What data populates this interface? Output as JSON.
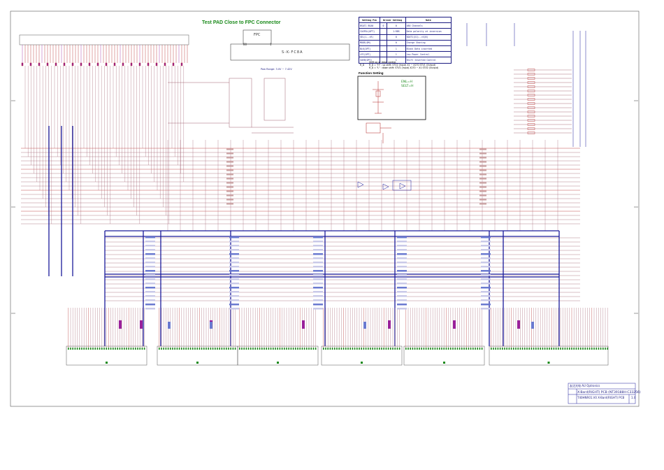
{
  "header": {
    "test_pad_title": "Test PAD Close to FPC Connector",
    "function_setting_title": "Function Setting"
  },
  "fpc": {
    "box_label": "FPC",
    "pin_first": "80",
    "pin_last": "1",
    "part_number": "S-K-FC8A",
    "power_range": "Pow Range: 3.0V ~ 7.42V"
  },
  "setting_table": {
    "headers": [
      "Setting Pin",
      "Driver Setting",
      "Note"
    ],
    "rows": [
      {
        "pin": "BSAT1  BSA0",
        "v1": "0",
        "v2": "0",
        "note": "480 Channels"
      },
      {
        "pin": "CASPOL(OPT)",
        "v1": "",
        "v2": "1:RBS",
        "note": "Data polarity at inversion"
      },
      {
        "pin": "SEL(L-->R)",
        "v1": "",
        "v2": "0",
        "note": "SOUT1(X1)-->X(N)"
      },
      {
        "pin": "MODE(OM)",
        "v1": "",
        "v2": "0",
        "note": "Charge Sharing"
      },
      {
        "pin": "BLK(OPT)",
        "v1": "",
        "v2": "1",
        "note": "Black Data inserted"
      },
      {
        "pin": "LPC(OPT)",
        "v1": "",
        "v2": "1",
        "note": "Low Power Control"
      },
      {
        "pin": "SOEB(OPT)",
        "v1": "",
        "v2": "1",
        "note": "Shift Inserted Control"
      }
    ],
    "footnote_key": "R_D",
    "footnote_lines": [
      "Shift up or down control.",
      "R_D = \"H\" : up shift: STV2 (Input) X1 ~ X270 STV1 (Output)",
      "R_D = \"L\" : down shift: STV1 (Input) X270 ~ X1 STV2 (Output)"
    ]
  },
  "function_setting": {
    "lines": [
      "ENL=H",
      "SELT=H"
    ]
  },
  "title_block": {
    "company": "友达光电  AU Optronics",
    "title": "X-Bard(RIGHT) PCB (NT39188H-C33256)",
    "drawing": "T40HNR01.V0 X-Bard(RIGHT) PCB",
    "revision": "1.0"
  },
  "colors": {
    "bus_blue": "#1a1a9a",
    "net_red": "#b02020",
    "net_mauve": "#a06070",
    "green": "#1a8a1a",
    "violet": "#9a209a",
    "pale_blue": "#6a7ad0"
  }
}
